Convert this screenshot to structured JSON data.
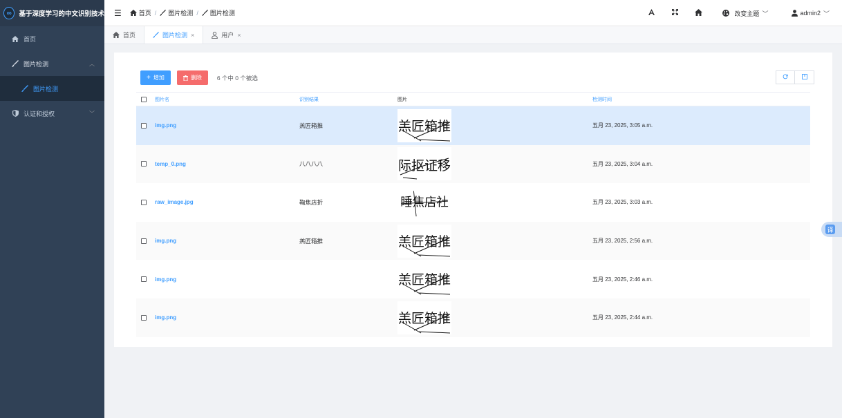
{
  "app": {
    "title": "基于深度学习的中文识别技术",
    "logo_glyph": "∞"
  },
  "sidebar": {
    "items": [
      {
        "label": "首页",
        "icon": "home-icon"
      },
      {
        "label": "图片检测",
        "icon": "brush-icon",
        "expanded": true
      },
      {
        "label": "图片检测",
        "icon": "brush-icon",
        "active": true
      },
      {
        "label": "认证和授权",
        "icon": "shield-icon"
      }
    ]
  },
  "breadcrumb": {
    "home": "首页",
    "sep": "/",
    "level1": "图片检测",
    "level2": "图片检测"
  },
  "header": {
    "theme_label": "改变主题",
    "user_name": "admin2"
  },
  "tabs": [
    {
      "label": "首页",
      "icon": "home-icon"
    },
    {
      "label": "图片检测",
      "icon": "brush-icon",
      "active": true,
      "close": "×"
    },
    {
      "label": "用户",
      "icon": "user-icon",
      "close": "×"
    }
  ],
  "toolbar": {
    "add_label": "增加",
    "add_glyph": "+",
    "delete_label": "删除",
    "selection_text": "6 个中 0 个被选"
  },
  "table": {
    "columns": [
      "图片名",
      "识别结果",
      "图片",
      "检测时间"
    ],
    "rows": [
      {
        "name": "img.png",
        "result": "羔匠箱推",
        "image_text": "羔匠箱推",
        "time": "五月 23, 2025, 3:05 a.m.",
        "selected": true
      },
      {
        "name": "temp_0.png",
        "result": "八八八八",
        "image_text": "际抠证移",
        "time": "五月 23, 2025, 3:04 a.m."
      },
      {
        "name": "raw_image.jpg",
        "result": "鞠焦店折",
        "image_text": "睡焦店社",
        "time": "五月 23, 2025, 3:03 a.m."
      },
      {
        "name": "img.png",
        "result": "羔匠箱推",
        "image_text": "羔匠箱推",
        "time": "五月 23, 2025, 2:56 a.m."
      },
      {
        "name": "img.png",
        "result": "",
        "image_text": "羔匠箱推",
        "time": "五月 23, 2025, 2:46 a.m."
      },
      {
        "name": "img.png",
        "result": "",
        "image_text": "羔匠箱推",
        "time": "五月 23, 2025, 2:44 a.m."
      }
    ]
  },
  "float": {
    "translate_label": "译"
  },
  "colors": {
    "sidebar_bg": "#304156",
    "accent": "#409eff",
    "danger": "#f56c6c",
    "selected_row": "#dcebfd"
  }
}
